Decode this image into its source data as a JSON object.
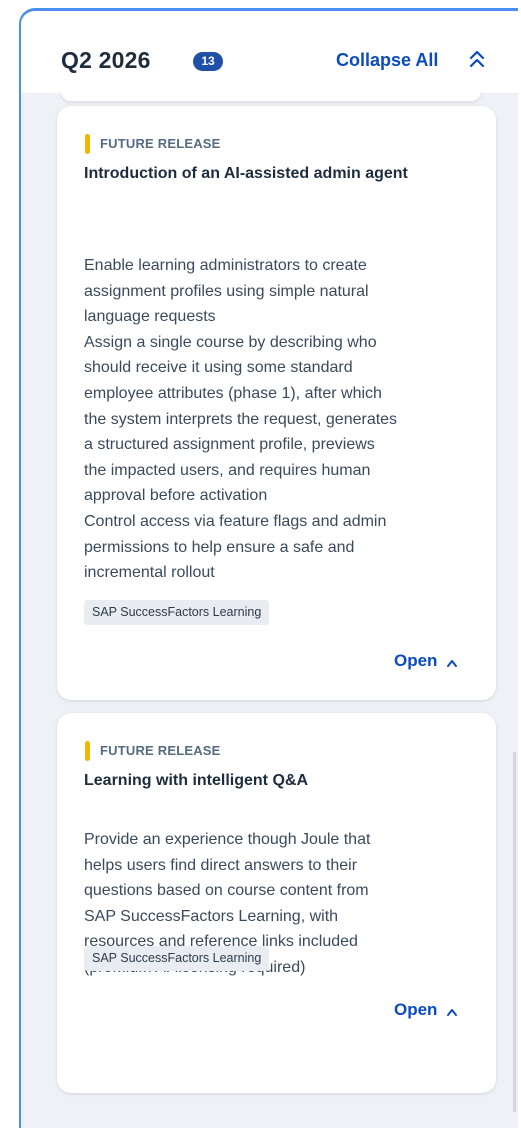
{
  "header": {
    "title": "Q2 2026",
    "count": "13",
    "collapse_all_label": "Collapse All",
    "collapse_all_icon": "double-chevron-up-icon"
  },
  "colors": {
    "accent": "#0a4bbf",
    "badge": "#1f4fa6",
    "release_marker": "#f5b400",
    "panel_border": "#4a8ff0"
  },
  "cards": [
    {
      "release_label": "FUTURE RELEASE",
      "title": "Introduction of an AI-assisted admin agent",
      "description_lines": [
        "Enable learning administrators to create",
        "assignment profiles using simple natural",
        "language requests",
        "Assign a single course by describing who",
        "should receive it using some standard",
        "employee attributes (phase 1), after which",
        "the system interprets the request, generates",
        "a structured assignment profile, previews",
        "the impacted users, and requires human",
        "approval before activation",
        "Control access via feature flags and admin",
        "permissions to help ensure a safe and",
        "incremental rollout"
      ],
      "product_tag": "SAP SuccessFactors Learning",
      "open_label": "Open"
    },
    {
      "release_label": "FUTURE RELEASE",
      "title": "Learning with intelligent Q&A",
      "description_lines": [
        "Provide an experience though Joule that",
        "helps users find direct answers to their",
        "questions based on course content from",
        "SAP SuccessFactors Learning, with",
        "resources and reference links included",
        "(premium AI licensing required)"
      ],
      "product_tag": "SAP SuccessFactors Learning",
      "open_label": "Open"
    }
  ]
}
